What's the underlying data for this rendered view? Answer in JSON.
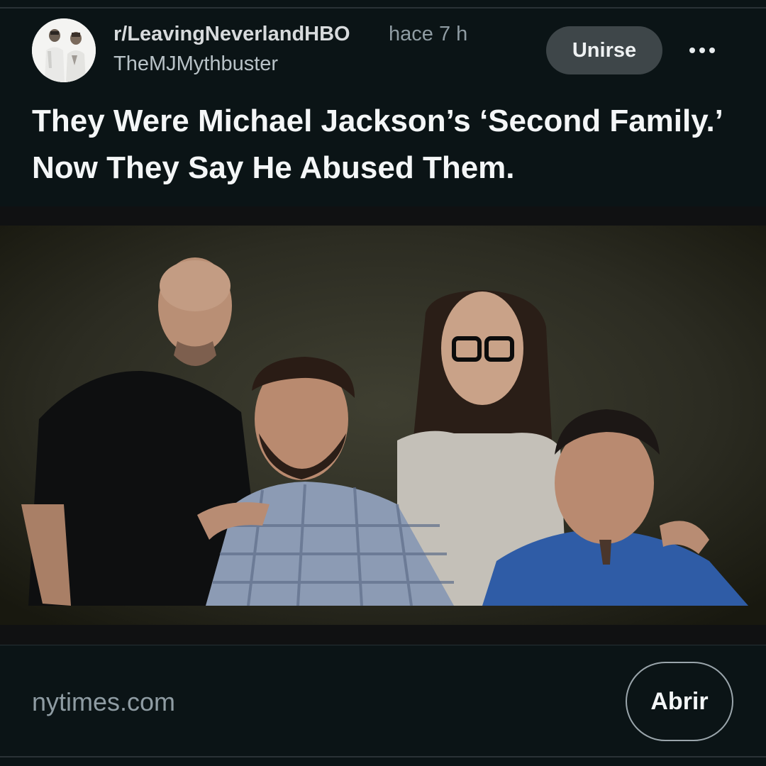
{
  "post": {
    "subreddit": "r/LeavingNeverlandHBO",
    "time": "hace 7 h",
    "author": "TheMJMythbuster",
    "title": "They Were Michael Jackson’s ‘Second Family.’ Now They Say He Abused Them.",
    "join_label": "Unirse",
    "more_icon": "more-horizontal-icon"
  },
  "link": {
    "domain": "nytimes.com",
    "open_label": "Abrir"
  },
  "colors": {
    "background": "#0b1416",
    "join_button": "#3e4649",
    "muted_text": "#8f9ca3"
  }
}
